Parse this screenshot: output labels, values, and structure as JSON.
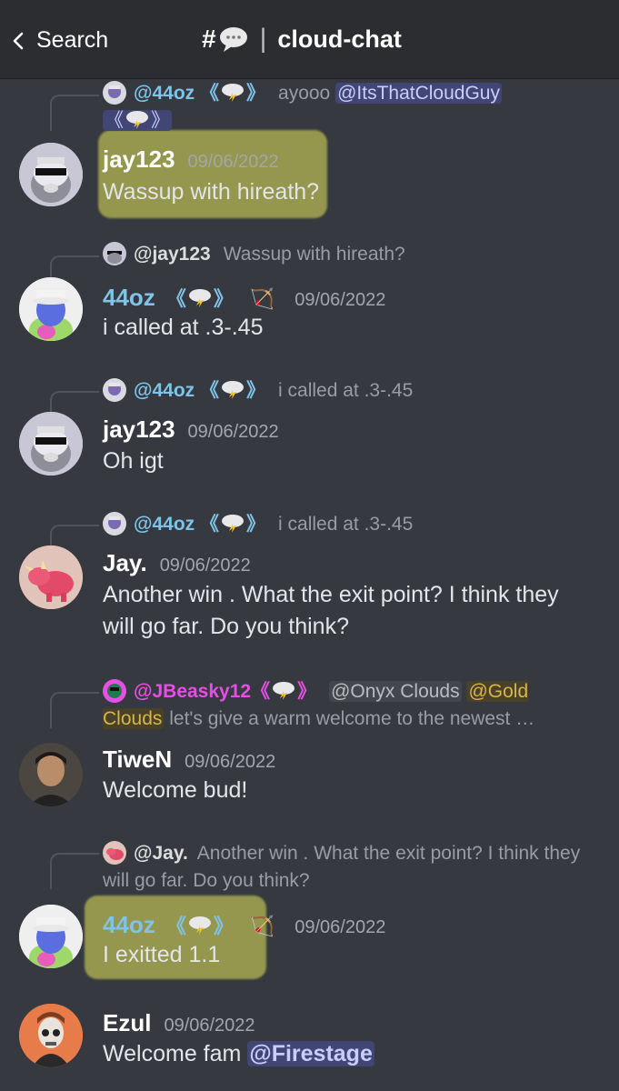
{
  "header": {
    "back_label": "Search",
    "hash": "#",
    "separator": "|",
    "channel_name": "cloud-chat"
  },
  "messages": [
    {
      "reply": {
        "user": "@44oz",
        "badge_open": "《",
        "badge_close": "》",
        "text": "ayooo",
        "mention": "@ItsThatCloudGuy",
        "mention_badge_open": "《",
        "mention_badge_close": "》"
      },
      "author": "jay123",
      "timestamp": "09/06/2022",
      "text": "Wassup with hireath?"
    },
    {
      "reply": {
        "user": "@jay123",
        "text": "Wassup with hireath?"
      },
      "author": "44oz",
      "badge_open": "《",
      "badge_close": "》",
      "timestamp": "09/06/2022",
      "text": "i called at .3-.45"
    },
    {
      "reply": {
        "user": "@44oz",
        "badge_open": "《",
        "badge_close": "》",
        "text": "i called at .3-.45"
      },
      "author": "jay123",
      "timestamp": "09/06/2022",
      "text": "Oh igt"
    },
    {
      "reply": {
        "user": "@44oz",
        "badge_open": "《",
        "badge_close": "》",
        "text": "i called at .3-.45"
      },
      "author": "Jay.",
      "timestamp": "09/06/2022",
      "text": "Another win . What the exit point? I think they will go far. Do you think?"
    },
    {
      "reply": {
        "user": "@JBeasky12",
        "badge_open": "《",
        "badge_close": "》",
        "mention1": "@Onyx Clouds",
        "mention2": "@Gold Clouds",
        "text": "let's give a warm welcome to the newest …"
      },
      "author": "TiweN",
      "timestamp": "09/06/2022",
      "text": "Welcome bud!"
    },
    {
      "reply": {
        "user": "@Jay.",
        "text": "Another win . What the exit point? I think they will go far. Do you think?"
      },
      "author": "44oz",
      "badge_open": "《",
      "badge_close": "》",
      "timestamp": "09/06/2022",
      "text": "I exitted 1.1"
    },
    {
      "author": "Ezul",
      "timestamp": "09/06/2022",
      "text": "Welcome fam",
      "mention": "@Firestage"
    }
  ],
  "icons": {
    "cloud": "cloud-lightning-icon",
    "bow": "bow-arrow-icon",
    "bow_glyph": "🏹"
  },
  "colors": {
    "background": "#36393f",
    "header_bg": "#2b2d31",
    "username_44oz": "#7fc3e8",
    "username_jbeasky": "#e64ee6",
    "mention_bg": "#414675",
    "highlight": "#e2e65a"
  }
}
